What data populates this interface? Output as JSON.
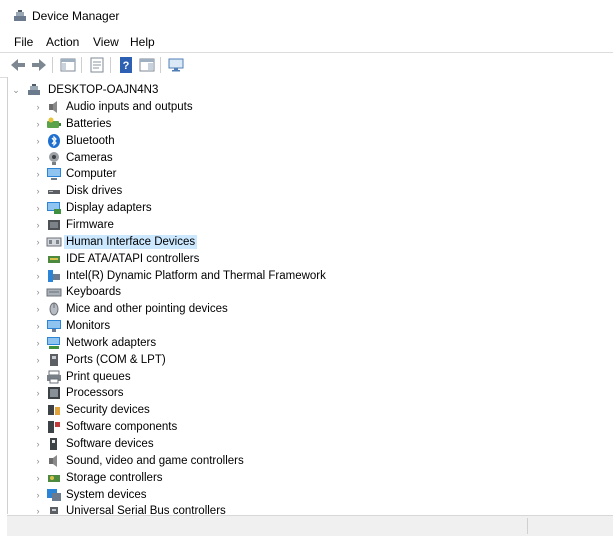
{
  "window": {
    "title": "Device Manager"
  },
  "menu": [
    "File",
    "Action",
    "View",
    "Help"
  ],
  "toolbar": [
    {
      "icon": "back-arrow-icon"
    },
    {
      "icon": "forward-arrow-icon"
    },
    {
      "icon": "show-hide-console-tree-icon"
    },
    {
      "icon": "properties-icon"
    },
    {
      "icon": "help-icon"
    },
    {
      "icon": "action-pane-icon"
    },
    {
      "icon": "scan-hardware-monitor-icon"
    }
  ],
  "tree": {
    "root": {
      "label": "DESKTOP-OAJN4N3",
      "expanded": true
    },
    "selected_index": 8,
    "categories": [
      {
        "label": "Audio inputs and outputs",
        "icon": "speaker-icon"
      },
      {
        "label": "Batteries",
        "icon": "battery-icon"
      },
      {
        "label": "Bluetooth",
        "icon": "bluetooth-icon"
      },
      {
        "label": "Cameras",
        "icon": "camera-icon"
      },
      {
        "label": "Computer",
        "icon": "computer-icon"
      },
      {
        "label": "Disk drives",
        "icon": "disk-drive-icon"
      },
      {
        "label": "Display adapters",
        "icon": "display-adapter-icon"
      },
      {
        "label": "Firmware",
        "icon": "firmware-icon"
      },
      {
        "label": "Human Interface Devices",
        "icon": "hid-icon"
      },
      {
        "label": "IDE ATA/ATAPI controllers",
        "icon": "ide-controller-icon"
      },
      {
        "label": "Intel(R) Dynamic Platform and Thermal Framework",
        "icon": "intel-platform-icon"
      },
      {
        "label": "Keyboards",
        "icon": "keyboard-icon"
      },
      {
        "label": "Mice and other pointing devices",
        "icon": "mouse-icon"
      },
      {
        "label": "Monitors",
        "icon": "monitor-icon"
      },
      {
        "label": "Network adapters",
        "icon": "network-adapter-icon"
      },
      {
        "label": "Ports (COM & LPT)",
        "icon": "port-icon"
      },
      {
        "label": "Print queues",
        "icon": "printer-icon"
      },
      {
        "label": "Processors",
        "icon": "processor-icon"
      },
      {
        "label": "Security devices",
        "icon": "security-device-icon"
      },
      {
        "label": "Software components",
        "icon": "software-component-icon"
      },
      {
        "label": "Software devices",
        "icon": "software-device-icon"
      },
      {
        "label": "Sound, video and game controllers",
        "icon": "sound-controller-icon"
      },
      {
        "label": "Storage controllers",
        "icon": "storage-controller-icon"
      },
      {
        "label": "System devices",
        "icon": "system-device-icon"
      },
      {
        "label": "Universal Serial Bus controllers",
        "icon": "usb-controller-icon"
      }
    ]
  }
}
